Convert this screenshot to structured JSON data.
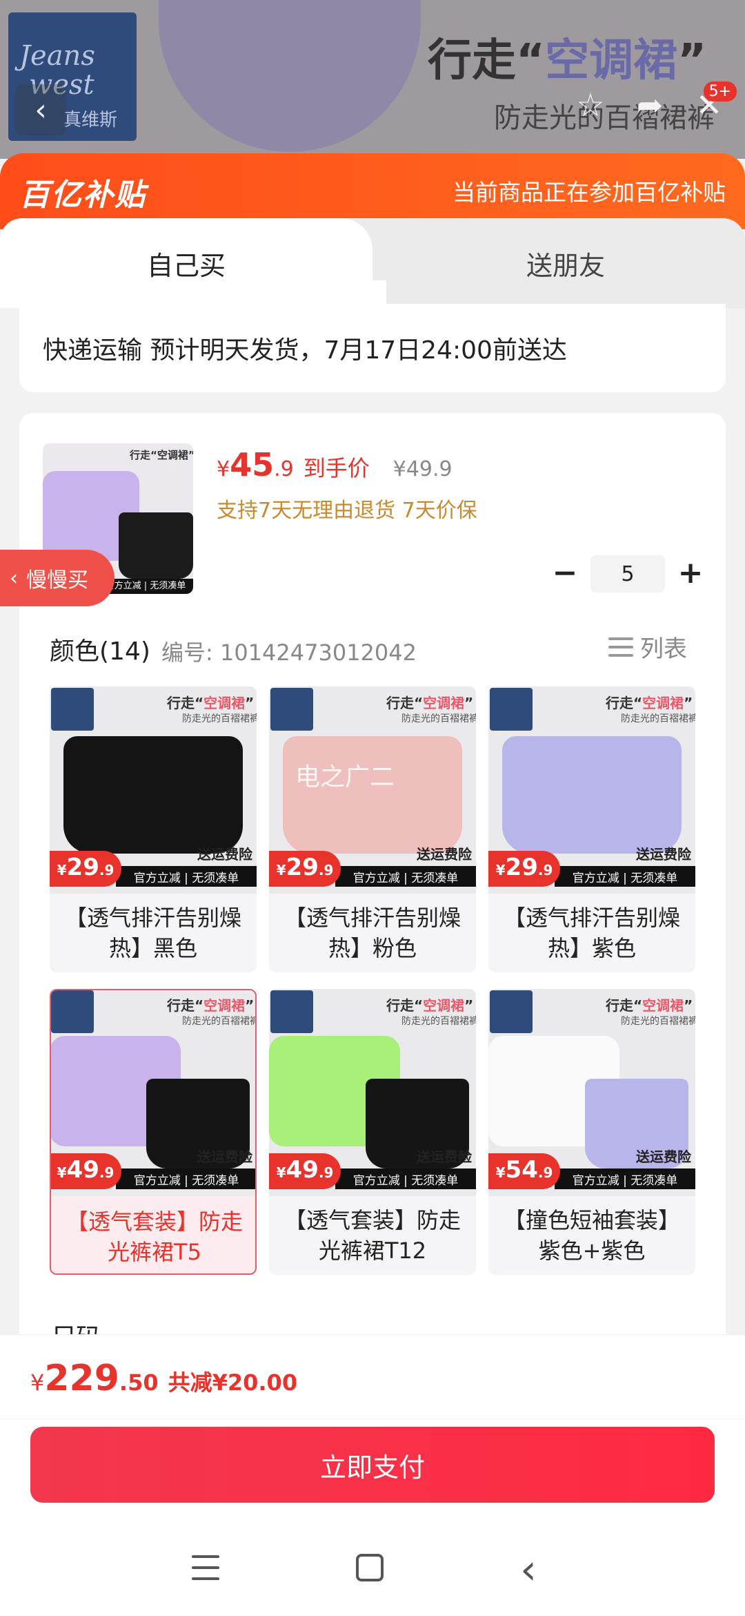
{
  "top": {
    "brand_line1": "Jeans",
    "brand_line2": "west",
    "brand_cn": "真维斯",
    "title_prefix": "行走“",
    "title_highlight": "空调裙",
    "title_suffix": "”",
    "subtitle": "防走光的百褶裙裤",
    "badge": "5+"
  },
  "subsidy": {
    "logo": "百亿补贴",
    "message": "当前商品正在参加百亿补贴"
  },
  "tabs": [
    {
      "label": "自己买"
    },
    {
      "label": "送朋友"
    }
  ],
  "shipping": {
    "text": "快递运输 预计明天发货，7月17日24:00前送达"
  },
  "product": {
    "thumb_title": "行走“空调裙”",
    "thumb_strip": "官方立减 | 无须凑单",
    "price_currency": "¥",
    "price_int": "45",
    "price_dec": ".9",
    "price_label": "到手价",
    "original_price": "¥49.9",
    "guarantee": "支持7天无理由退货 7天价保",
    "quantity": "5",
    "minus": "−",
    "plus": "+"
  },
  "slow_buy": {
    "label": "慢慢买",
    "arrow": "‹"
  },
  "color_section": {
    "title": "颜色(14)",
    "code": "编号: 10142473012042",
    "list_label": "列表"
  },
  "variants": [
    {
      "price_int": "29",
      "price_dec": ".9",
      "name": "【透气排汗告别燥热】黑色",
      "skirt_color": "#141414"
    },
    {
      "price_int": "29",
      "price_dec": ".9",
      "name": "【透气排汗告别燥热】粉色",
      "skirt_color": "#efbfbd"
    },
    {
      "price_int": "29",
      "price_dec": ".9",
      "name": "【透气排汗告别燥热】紫色",
      "skirt_color": "#b8b5ea"
    },
    {
      "price_int": "49",
      "price_dec": ".9",
      "name": "【透气套装】防走光裤裙T5",
      "shirt_color": "#c9b3ec",
      "skirt_color": "#151515"
    },
    {
      "price_int": "49",
      "price_dec": ".9",
      "name": "【透气套装】防走光裤裙T12",
      "shirt_color": "#a8f07a",
      "skirt_color": "#151515"
    },
    {
      "price_int": "54",
      "price_dec": ".9",
      "name": "【撞色短袖套装】紫色+紫色",
      "shirt_color": "#fafafa",
      "skirt_color": "#b8b5ea"
    }
  ],
  "variant_common": {
    "headline_prefix": "行走“",
    "headline_highlight": "空调裙",
    "headline_suffix": "”",
    "sub": "防走光的百褶裙裤",
    "currency": "¥",
    "strip": "官方立减 | 无须凑单",
    "ship_tag": "送运费险"
  },
  "watermark": "电之广二",
  "partial_title": "尺码",
  "footer": {
    "currency": "¥",
    "total_int": "229",
    "total_dec": ".50",
    "save": "共减¥20.00",
    "pay_button": "立即支付"
  },
  "colors": {
    "accent_red": "#e8322c",
    "subsidy_orange": "#ff5a1c",
    "pay_button": "#f2374f",
    "selected_border": "#e85a6a"
  }
}
